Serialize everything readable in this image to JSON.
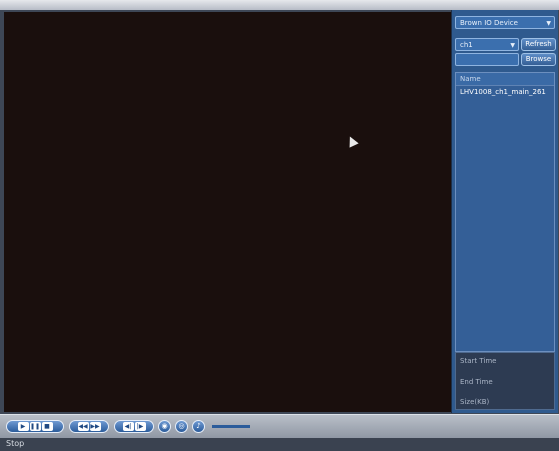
{
  "sidebar": {
    "camera_select": "Brown IO Device",
    "channel_select": "ch1",
    "refresh_label": "Refresh",
    "browse_label": "Browse",
    "path_value": ""
  },
  "file_list": {
    "header": "Name",
    "rows": [
      "LHV1008_ch1_main_261"
    ]
  },
  "details": {
    "start_time_label": "Start Time",
    "end_time_label": "End Time",
    "size_label": "Size(KB)"
  },
  "playback_toolbar": {
    "buttons": [
      "play-icon",
      "pause-icon",
      "stop-icon",
      "slow-icon",
      "fast-icon",
      "prev-frame-icon",
      "next-frame-icon",
      "snapshot-icon",
      "clip-icon",
      "audio-icon"
    ]
  },
  "status": {
    "text": "Stop"
  }
}
